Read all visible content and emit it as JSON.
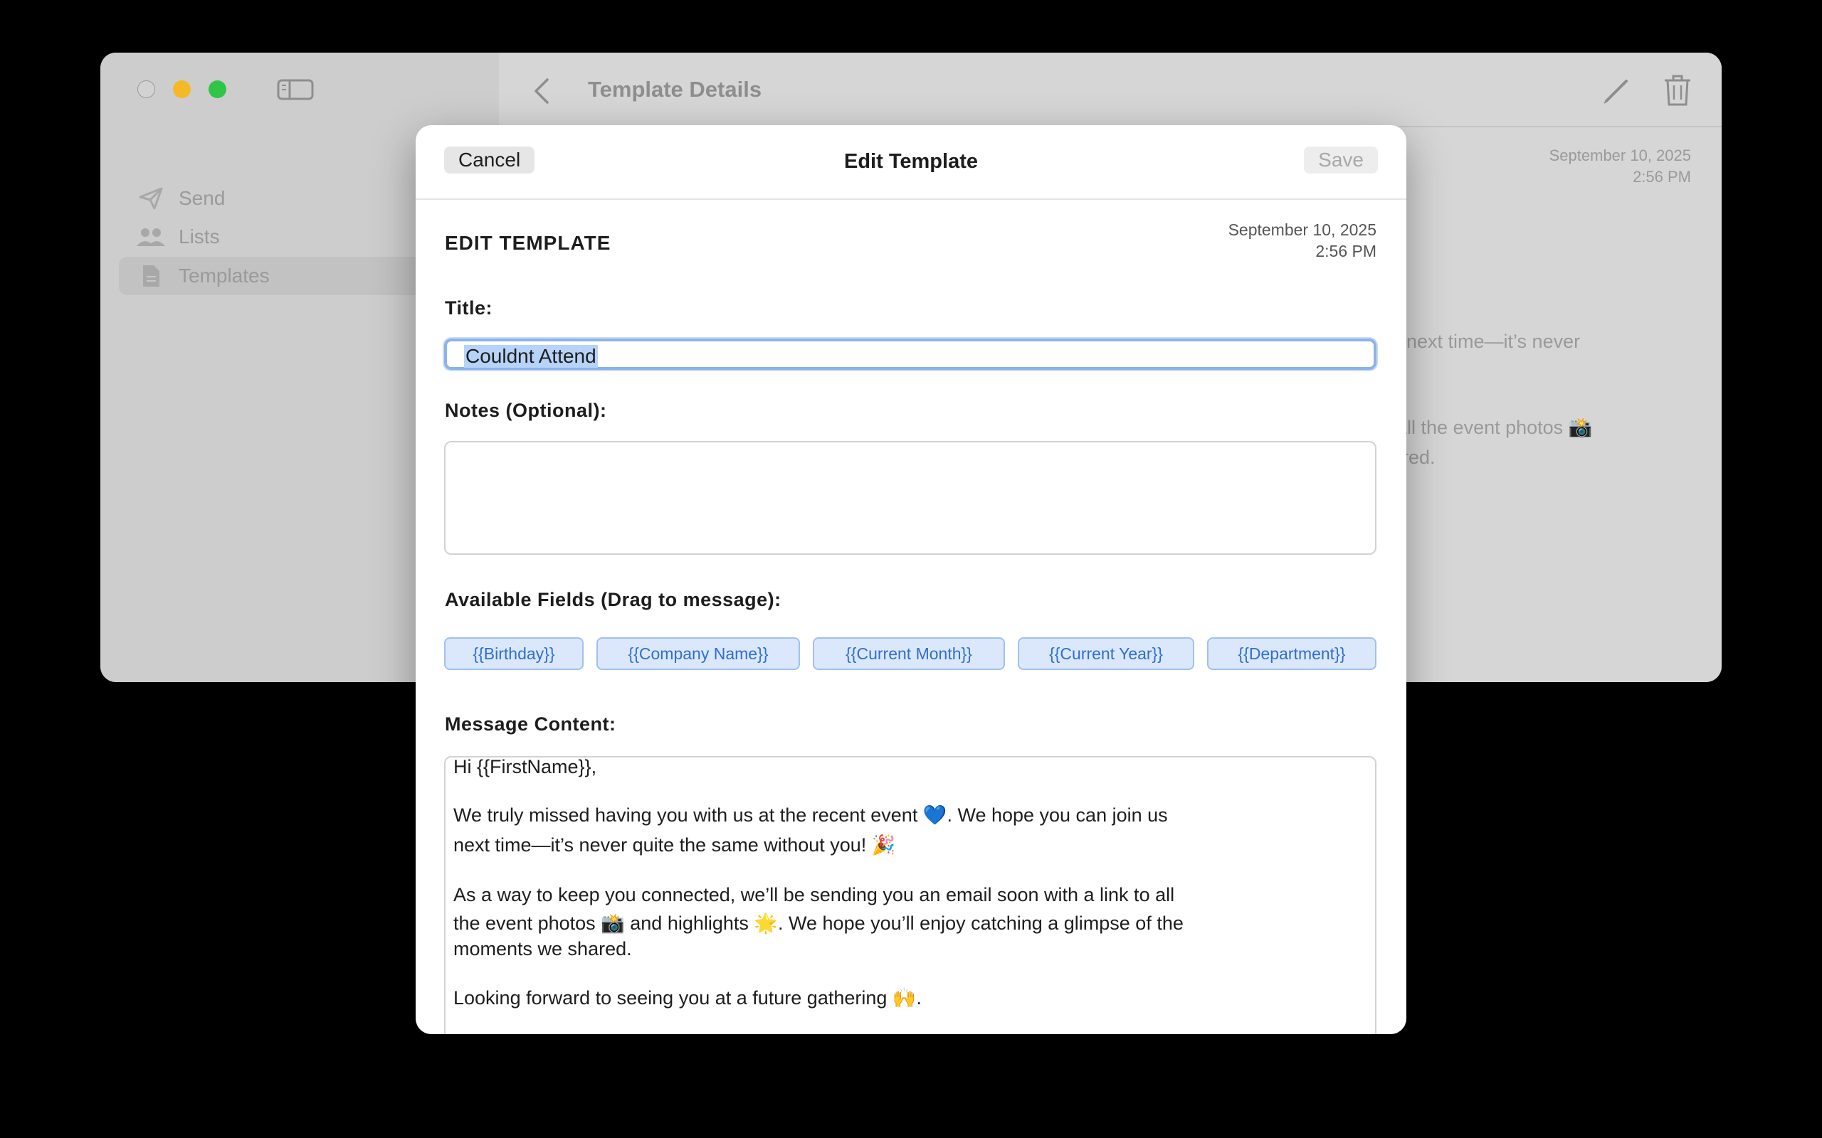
{
  "window": {
    "sidebar": {
      "items": [
        {
          "label": "Send",
          "icon": "paper-plane-icon"
        },
        {
          "label": "Lists",
          "icon": "people-icon"
        },
        {
          "label": "Templates",
          "icon": "document-icon"
        }
      ]
    },
    "main": {
      "title": "Template Details",
      "date_line1": "September 10, 2025",
      "date_line2": "2:56 PM",
      "preview_line1": "s next time—it’s never",
      "preview_line2": "all the event photos 📸",
      "preview_line3": "red."
    }
  },
  "sheet": {
    "title": "Edit Template",
    "cancel_label": "Cancel",
    "save_label": "Save",
    "section_heading": "EDIT TEMPLATE",
    "date_line1": "September 10, 2025",
    "date_line2": "2:56 PM",
    "title_label": "Title:",
    "title_value": "Couldnt Attend",
    "notes_label": "Notes (Optional):",
    "notes_value": "",
    "fields_label": "Available Fields (Drag to message):",
    "fields": [
      "{{Birthday}}",
      "{{Company Name}}",
      "{{Current Month}}",
      "{{Current Year}}",
      "{{Department}}"
    ],
    "message_label": "Message Content:",
    "message_lines": [
      "Hi {{FirstName}},",
      "We truly missed having you with us at the recent event 💙. We hope you can join us",
      "next time—it’s never quite the same without you! 🎉",
      "As a way to keep you connected, we’ll be sending you an email soon with a link to all",
      "the event photos 📸 and highlights 🌟. We hope you’ll enjoy catching a glimpse of the",
      "moments we shared.",
      "Looking forward to seeing you at a future gathering 🙌."
    ]
  },
  "colors": {
    "accent": "#2f6fd2",
    "chip_bg": "#dbe8fb",
    "traffic_min": "#f5b827",
    "traffic_max": "#31c548"
  }
}
